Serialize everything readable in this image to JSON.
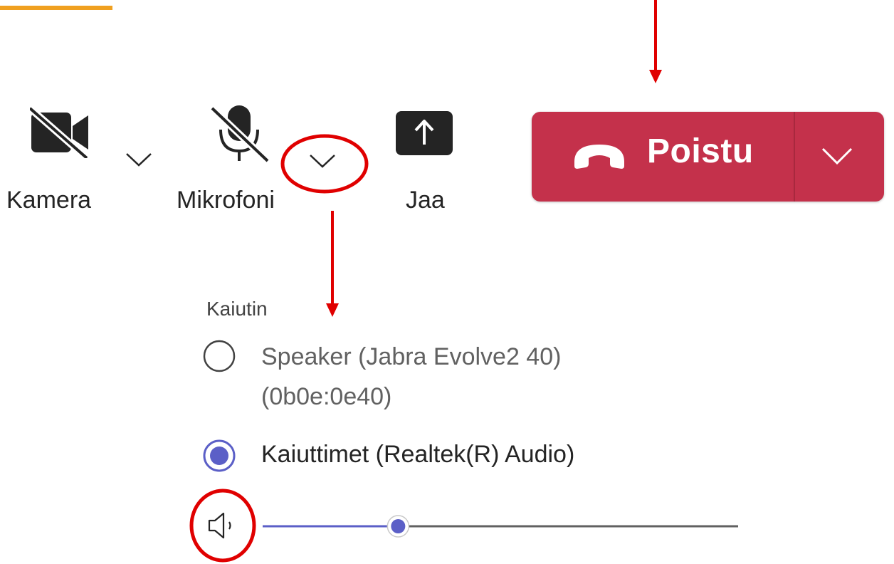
{
  "toolbar": {
    "camera": {
      "label": "Kamera",
      "icon": "video-off-icon",
      "menu_icon": "chevron-down-icon"
    },
    "microphone": {
      "label": "Mikrofoni",
      "icon": "mic-off-icon",
      "menu_icon": "chevron-down-icon"
    },
    "share": {
      "label": "Jaa",
      "icon": "share-screen-icon"
    },
    "leave": {
      "label": "Poistu",
      "icon": "phone-hangup-icon",
      "menu_icon": "chevron-down-icon",
      "color": "#c4314b"
    }
  },
  "speaker_menu": {
    "title": "Kaiutin",
    "options": [
      {
        "line1": "Speaker (Jabra Evolve2 40)",
        "line2": "(0b0e:0e40)",
        "selected": false
      },
      {
        "line1": "Kaiuttimet (Realtek(R) Audio)",
        "selected": true
      }
    ],
    "volume": {
      "icon": "speaker-volume-icon",
      "value": 0.27
    }
  },
  "colors": {
    "accent": "#5b5fc7",
    "annotation": "#e00000",
    "tab_indicator": "#f0a020"
  }
}
